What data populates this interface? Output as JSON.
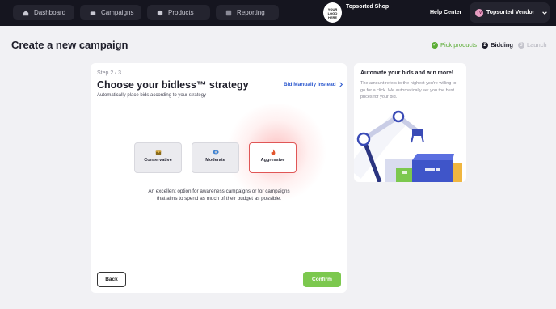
{
  "nav": {
    "tabs": [
      {
        "label": "Dashboard",
        "icon": "home-icon"
      },
      {
        "label": "Campaigns",
        "icon": "car-icon"
      },
      {
        "label": "Products",
        "icon": "box-icon"
      },
      {
        "label": "Reporting",
        "icon": "report-icon"
      }
    ],
    "logo_text": [
      "YOUR",
      "LOGO",
      "HERE"
    ],
    "shop_name": "Topsorted Shop",
    "help": "Help Center",
    "vendor": {
      "initials": "TV",
      "name": "Topsorted Vendor"
    }
  },
  "page": {
    "title": "Create a new campaign"
  },
  "steps": [
    {
      "label": "Pick products",
      "state": "done"
    },
    {
      "label": "Bidding",
      "state": "current",
      "number": "2"
    },
    {
      "label": "Launch",
      "state": "upcoming",
      "number": "3"
    }
  ],
  "strategy": {
    "step": "Step 2 / 3",
    "title": "Choose your bidless™ strategy",
    "subtitle": "Automatically place bids according to your strategy",
    "manual_link": "Bid Manually Instead",
    "options": [
      {
        "label": "Conservative",
        "icon": "treasure-icon",
        "selected": false
      },
      {
        "label": "Moderate",
        "icon": "eye-icon",
        "selected": false
      },
      {
        "label": "Aggressive",
        "icon": "fire-icon",
        "selected": true
      }
    ],
    "description": "An excellent option for awareness campaigns or for campaigns that aims to spend as much of their budget as possible.",
    "back": "Back",
    "confirm": "Confirm"
  },
  "side": {
    "title": "Automate your bids and win more!",
    "body": "The amount refers to the highest you're willing to go for a click. We automatically set you the best prices for your bid."
  },
  "colors": {
    "nav_bg": "#15151f",
    "accent_green": "#7cc84e",
    "link_blue": "#2f5bcf",
    "selected_border": "#e05656"
  }
}
